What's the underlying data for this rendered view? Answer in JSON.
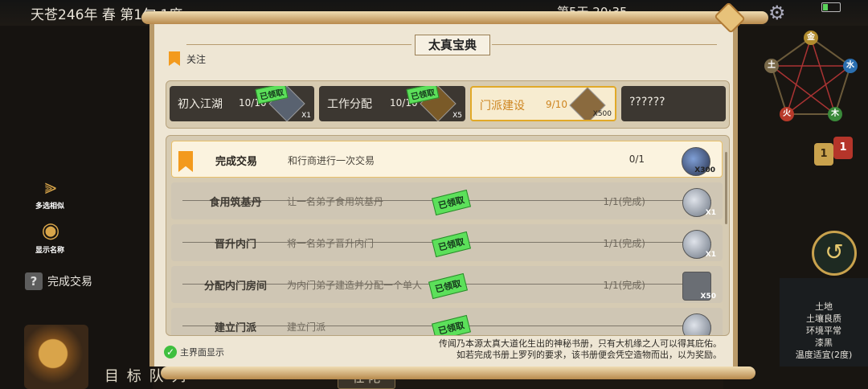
{
  "status_bar": {
    "date": "天苍246年 春 第1旬 1度",
    "day_time": "第5天 20:35"
  },
  "panel": {
    "title": "太真宝典",
    "follow_label": "关注",
    "tabs": [
      {
        "name": "初入江湖",
        "count": "10/10",
        "claimed": "已领取",
        "qty": "X1",
        "active": false
      },
      {
        "name": "工作分配",
        "count": "10/10",
        "claimed": "已领取",
        "qty": "X5",
        "active": false
      },
      {
        "name": "门派建设",
        "count": "9/10",
        "claimed": "",
        "qty": "X500",
        "active": true
      },
      {
        "name": "??????",
        "count": "",
        "claimed": "",
        "qty": "",
        "active": false
      }
    ],
    "quests": [
      {
        "name": "完成交易",
        "desc": "和行商进行一次交易",
        "progress": "0/1",
        "qty": "X300",
        "done": false,
        "stamp": ""
      },
      {
        "name": "食用筑基丹",
        "desc": "让一名弟子食用筑基丹",
        "progress": "1/1(完成)",
        "qty": "X1",
        "done": true,
        "stamp": "已领取"
      },
      {
        "name": "晋升内门",
        "desc": "将一名弟子晋升内门",
        "progress": "1/1(完成)",
        "qty": "X1",
        "done": true,
        "stamp": "已领取"
      },
      {
        "name": "分配内门房间",
        "desc": "为内门弟子建造并分配一个单人",
        "progress": "1/1(完成)",
        "qty": "X50",
        "done": true,
        "stamp": "已领取"
      },
      {
        "name": "建立门派",
        "desc": "建立门派",
        "progress": "",
        "qty": "",
        "done": true,
        "stamp": "已领取"
      }
    ],
    "show_on_main": "主界面显示",
    "footer_line1": "传闻乃本源太真大道化生出的神秘书册，只有大机缘之人可以得其庇佑。",
    "footer_line2": "如若完成书册上罗列的要求，该书册便会凭空造物而出，以为奖励。"
  },
  "left_side": {
    "multi_select": "多选相似",
    "show_names": "显示名称",
    "current_quest": "完成交易",
    "bottom_nav": "目 标 队 列",
    "bottom_mid": "任 陀"
  },
  "right_side": {
    "elements": {
      "metal": "金",
      "water": "水",
      "wood": "木",
      "fire": "火",
      "earth": "土"
    },
    "badge_gold": "1",
    "badge_red": "1",
    "terrain": [
      "土地",
      "土壤良质",
      "环境平常",
      "漆黑",
      "温度适宜(2度)"
    ]
  },
  "colors": {
    "accent": "#f39a1d",
    "claimed": "#5ce05a",
    "active_tab": "#ce8520"
  }
}
